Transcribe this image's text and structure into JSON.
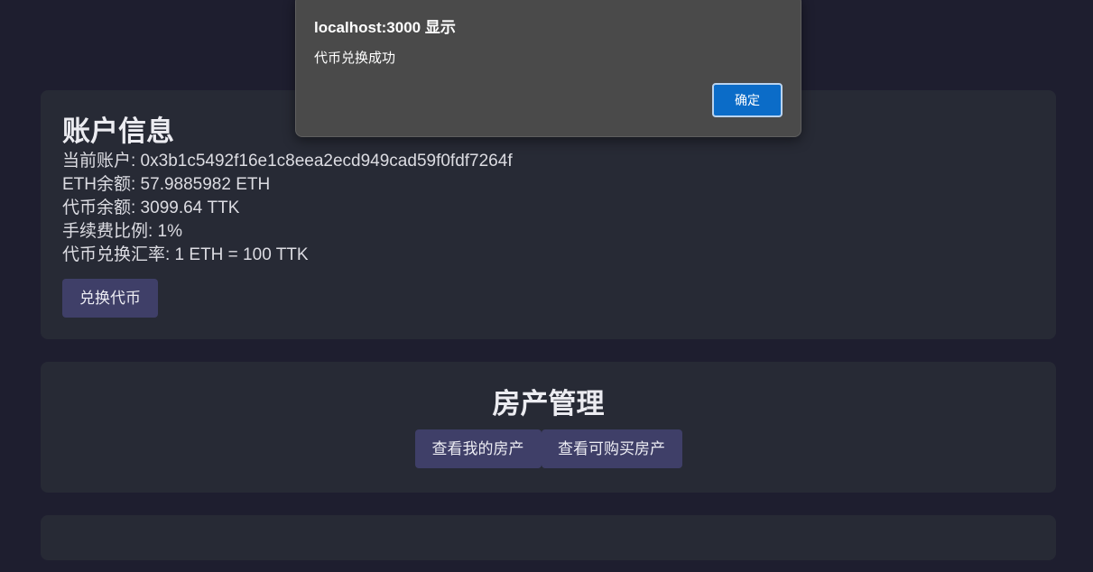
{
  "account": {
    "title": "账户信息",
    "current_account": "当前账户: 0x3b1c5492f16e1c8eea2ecd949cad59f0fdf7264f",
    "eth_balance": "ETH余额: 57.9885982 ETH",
    "token_balance": "代币余额: 3099.64 TTK",
    "fee_rate": "手续费比例: 1%",
    "exchange_rate": "代币兑换汇率: 1 ETH = 100 TTK",
    "exchange_button": "兑换代币"
  },
  "property": {
    "title": "房产管理",
    "my_property_button": "查看我的房产",
    "buyable_property_button": "查看可购买房产"
  },
  "dialog": {
    "title": "localhost:3000 显示",
    "message": "代币兑换成功",
    "ok_button": "确定"
  },
  "colors": {
    "background": "#1e1e2f",
    "card": "#272a35",
    "button": "#3f3f68",
    "dialog_ok": "#0b6cc8"
  }
}
